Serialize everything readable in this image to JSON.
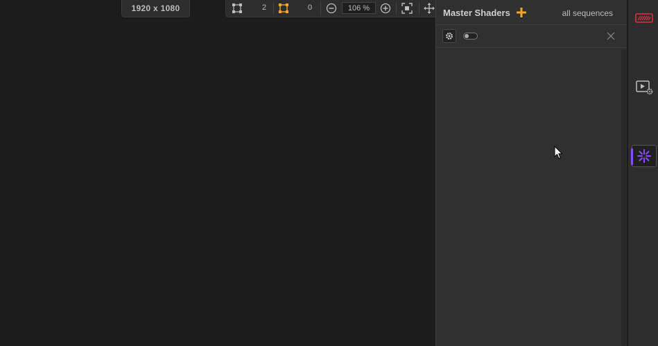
{
  "resolution": {
    "label": "1920 x 1080"
  },
  "toolbar": {
    "selected_points_count": "2",
    "selected_handles_count": "0",
    "zoom_value": "106 %"
  },
  "panel": {
    "title": "Master Shaders",
    "scope_label": "all sequences",
    "shader_toggle_on": false
  },
  "colors": {
    "accent_add": "#f5a623",
    "accent_handles": "#f5a623",
    "accent_active": "#8a4dff",
    "accent_warning": "#e03040"
  },
  "sidebar": {
    "items": [
      {
        "icon": "red-device-icon"
      },
      {
        "icon": "video-settings-icon"
      },
      {
        "icon": "shader-spark-icon",
        "active": true
      }
    ]
  }
}
